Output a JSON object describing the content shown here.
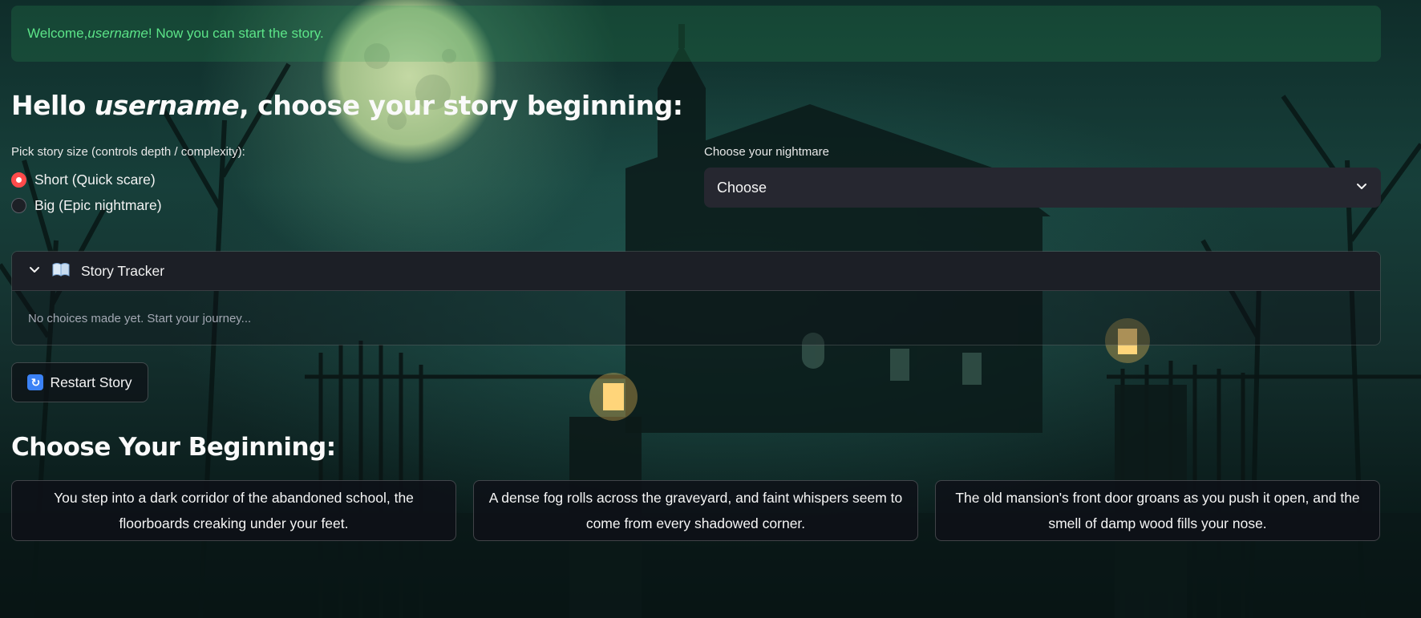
{
  "alert": {
    "prefix": "Welcome, ",
    "username": "username",
    "suffix": "! Now you can start the story."
  },
  "header": {
    "hello": "Hello ",
    "username": "username",
    "rest": ", choose your story beginning:"
  },
  "story_size": {
    "label": "Pick story size (controls depth / complexity):",
    "options": [
      {
        "label": "Short (Quick scare)",
        "selected": true
      },
      {
        "label": "Big (Epic nightmare)",
        "selected": false
      }
    ]
  },
  "nightmare_select": {
    "label": "Choose your nightmare",
    "value": "Choose"
  },
  "tracker": {
    "icon": "open-book-icon",
    "title": "Story Tracker",
    "empty_text": "No choices made yet. Start your journey..."
  },
  "restart": {
    "icon": "restart-icon",
    "label": "Restart Story"
  },
  "beginnings": {
    "title": "Choose Your Beginning:",
    "options": [
      "You step into a dark corridor of the abandoned school, the floorboards creaking under your feet.",
      "A dense fog rolls across the graveyard, and faint whispers seem to come from every shadowed corner.",
      "The old mansion's front door groans as you push it open, and the smell of damp wood fills your nose."
    ]
  },
  "colors": {
    "accent": "#ff4b4b",
    "success_text": "#5ce488",
    "widget_bg": "#262730"
  }
}
